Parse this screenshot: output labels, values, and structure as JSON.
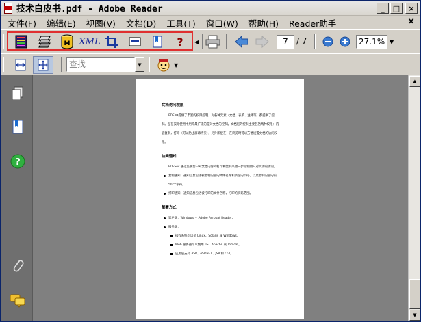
{
  "window": {
    "title": "技术白皮书.pdf - Adobe Reader",
    "controls": {
      "minimize": "_",
      "maximize": "□",
      "close": "×"
    }
  },
  "menu": {
    "items": [
      "文件(F)",
      "编辑(E)",
      "视图(V)",
      "文档(D)",
      "工具(T)",
      "窗口(W)",
      "帮助(H)",
      "Reader助手"
    ],
    "close_glyph": "×"
  },
  "toolbar": {
    "highlighted_icons": [
      "pages-stack-icon",
      "layers-icon",
      "database-icon",
      "xml-icon",
      "crop-icon",
      "form-field-icon",
      "bookmark-page-icon",
      "help-icon"
    ],
    "xml_label": "XML",
    "help_label": "?",
    "current_page": "7",
    "total_pages": "/ 7",
    "zoom": "27.1%",
    "highlight_color": "#e03030"
  },
  "toolbar2": {
    "search_placeholder": "查找"
  },
  "nav_pane": {
    "icons": [
      "pages-icon",
      "bookmarks-icon",
      "help-icon",
      "attachments-icon",
      "comments-icon"
    ],
    "help_glyph": "?"
  },
  "page": {
    "sections": [
      {
        "heading": "文档访问权限",
        "paragraphs": [
          "PDF 中提供了丰富的权限控制，对各种元素（文档、表单、注释等）都提供了控制。但在实际使用中用得最广泛的是对文档的控制。文档层的控制主要包括两种权限：内容复制，打印（可以防止屏幕拷贝），另外即使在，在浏览时可以方便设置文档的访问权限。"
        ]
      },
      {
        "heading": "访问通知",
        "paragraphs": [
          "PDFSec 通过监视客户对文档内容的打印和复制来进一步控制用户对资源的访问。"
        ],
        "bullets": [
          "复制通知：通知信息包括被复制内容的文件名称和所在的页码，以及复制内容的前 50 个字符。",
          "打印通知：通知信息包括被打印的文件名称，打印的页码范围。"
        ]
      },
      {
        "heading": "部署方式",
        "bullets": [
          "客户端：Windows + Adobe Acrobat Reader。",
          "服务端："
        ],
        "sub_bullets": [
          "操作系统可以是 Linux、Solaris 或 Windows。",
          "Web 服务器可以使用 IIS、Apache 或 Tomcat。",
          "应用层支持 ASP、ASP.NET、JSP 和 CGI。"
        ]
      }
    ]
  }
}
